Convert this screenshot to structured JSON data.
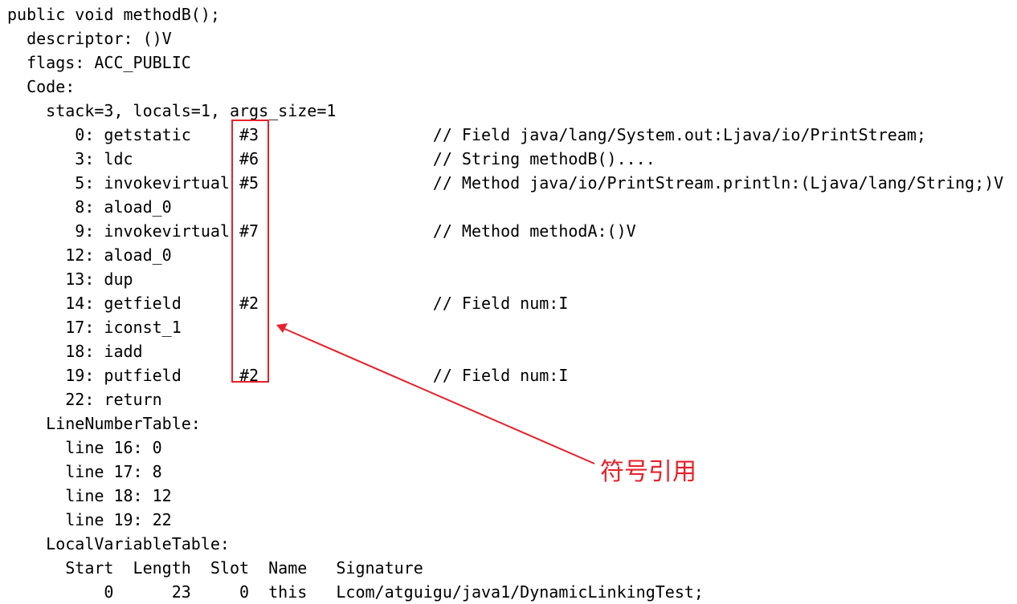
{
  "lines": [
    "public void methodB();",
    "  descriptor: ()V",
    "  flags: ACC_PUBLIC",
    "  Code:",
    "    stack=3, locals=1, args_size=1",
    "       0: getstatic     #3                  // Field java/lang/System.out:Ljava/io/PrintStream;",
    "       3: ldc           #6                  // String methodB()....",
    "       5: invokevirtual #5                  // Method java/io/PrintStream.println:(Ljava/lang/String;)V",
    "       8: aload_0",
    "       9: invokevirtual #7                  // Method methodA:()V",
    "      12: aload_0",
    "      13: dup",
    "      14: getfield      #2                  // Field num:I",
    "      17: iconst_1",
    "      18: iadd",
    "      19: putfield      #2                  // Field num:I",
    "      22: return",
    "    LineNumberTable:",
    "      line 16: 0",
    "      line 17: 8",
    "      line 18: 12",
    "      line 19: 22",
    "    LocalVariableTable:",
    "      Start  Length  Slot  Name   Signature",
    "          0      23     0  this   Lcom/atguigu/java1/DynamicLinkingTest;"
  ],
  "annotation": {
    "label": "符号引用",
    "color": "#e8202a"
  }
}
